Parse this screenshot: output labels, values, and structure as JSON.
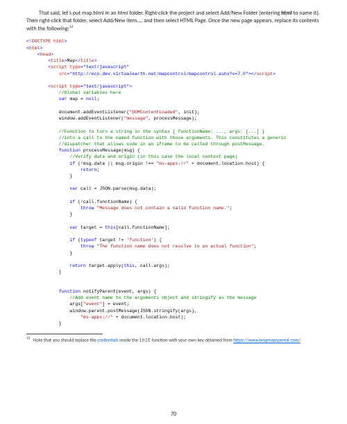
{
  "intro": {
    "lead": "That said, let's put map.html in an ",
    "italic": "html",
    "mid1": " folder. Right-click the project and select Add/New Folder (entering ",
    "bold": "html",
    "mid2": " to name it). Then right-click that folder, select Add/New Item..., and then select HTML Page. Once the new page appears, replace its contents with the following:",
    "sup": "12"
  },
  "code": {
    "l01a": "<!",
    "l01b": "DOCTYPE",
    "l01c": " ",
    "l01d": "html",
    "l01e": ">",
    "l02a": "<",
    "l02b": "html",
    "l02c": ">",
    "l03a": "    <",
    "l03b": "head",
    "l03c": ">",
    "l04a": "        <",
    "l04b": "title",
    "l04c": ">",
    "l04d": "Map",
    "l04e": "</",
    "l04f": "title",
    "l04g": ">",
    "l05a": "        <",
    "l05b": "script",
    "l05c": " ",
    "l05d": "type",
    "l05e": "=\"text/javascript\"",
    "l06a": "            ",
    "l06b": "src",
    "l06c": "=\"http://ecn.dev.virtualearth.net/mapcontrol/mapcontrol.ashx?v=7.0\"",
    "l06d": "></",
    "l06e": "script",
    "l06f": ">",
    "blank1": "",
    "l07a": "        <",
    "l07b": "script",
    "l07c": " ",
    "l07d": "type",
    "l07e": "=\"text/javascript\"",
    "l07f": ">",
    "l08": "            //Global variables here",
    "l09a": "            ",
    "l09b": "var",
    "l09c": " map = ",
    "l09d": "null",
    "l09e": ";",
    "blank2": "",
    "l10a": "            document.addEventListener(",
    "l10b": "\"DOMContentLoaded\"",
    "l10c": ", init);",
    "l11a": "            window.addEventListener(",
    "l11b": "\"message\"",
    "l11c": ", processMessage);",
    "blank3": "",
    "l12": "            //Function to turn a string in the syntax { functionName: ..., args: [...] }",
    "l13": "            //into a call to the named function with those arguments. This constitutes a generic",
    "l14": "            //dispatcher that allows code in an iframe to be called through postMessage.",
    "l15a": "            ",
    "l15b": "function",
    "l15c": " processMessage(msg) {",
    "l16": "                //Verify data and origin (in this case the local context page)",
    "l17a": "                ",
    "l17b": "if",
    "l17c": " (!msg.data || msg.origin !== ",
    "l17d": "\"ms-appx://\"",
    "l17e": " + document.location.host) {",
    "l18a": "                    ",
    "l18b": "return",
    "l18c": ";",
    "l19": "                }",
    "blank4": "",
    "l20a": "                ",
    "l20b": "var",
    "l20c": " call = JSON.parse(msg.data);",
    "blank5": "",
    "l21a": "                ",
    "l21b": "if",
    "l21c": " (!call.functionName) {",
    "l22a": "                    ",
    "l22b": "throw",
    "l22c": " ",
    "l22d": "\"Message does not contain a valid function name.\"",
    "l22e": ";",
    "l23": "                }",
    "blank6": "",
    "l24a": "                ",
    "l24b": "var",
    "l24c": " target = ",
    "l24d": "this",
    "l24e": "[call.functionName];",
    "blank7": "",
    "l25a": "                ",
    "l25b": "if",
    "l25c": " (",
    "l25d": "typeof",
    "l25e": " target != ",
    "l25f": "'function'",
    "l25g": ") {",
    "l26a": "                    ",
    "l26b": "throw",
    "l26c": " ",
    "l26d": "\"The function name does not resolve to an actual function\"",
    "l26e": ";",
    "l27": "                }",
    "blank8": "",
    "l28a": "                ",
    "l28b": "return",
    "l28c": " target.apply(",
    "l28d": "this",
    "l28e": ", call.args);",
    "l29": "            }",
    "blank9": "",
    "blank10": "",
    "l30a": "            ",
    "l30b": "function",
    "l30c": " notifyParent(event, args) {",
    "l31": "                //Add event name to the arguments object and stringify as the message",
    "l32a": "                args[",
    "l32b": "\"event\"",
    "l32c": "] = event;",
    "l33": "                window.parent.postMessage(JSON.stringify(args),",
    "l34a": "                    ",
    "l34b": "\"ms-appx://\"",
    "l34c": " + document.location.host);",
    "l35": "            }"
  },
  "footnote": {
    "mark": "12",
    "text1": " Note that you should replace the ",
    "cred": "credentials",
    "text2": " inside the ",
    "mono": "init",
    "text3": " function with your own key obtained from ",
    "link": "https://www.bingmapsportal.com/",
    "period": "."
  },
  "pageNumber": "70"
}
